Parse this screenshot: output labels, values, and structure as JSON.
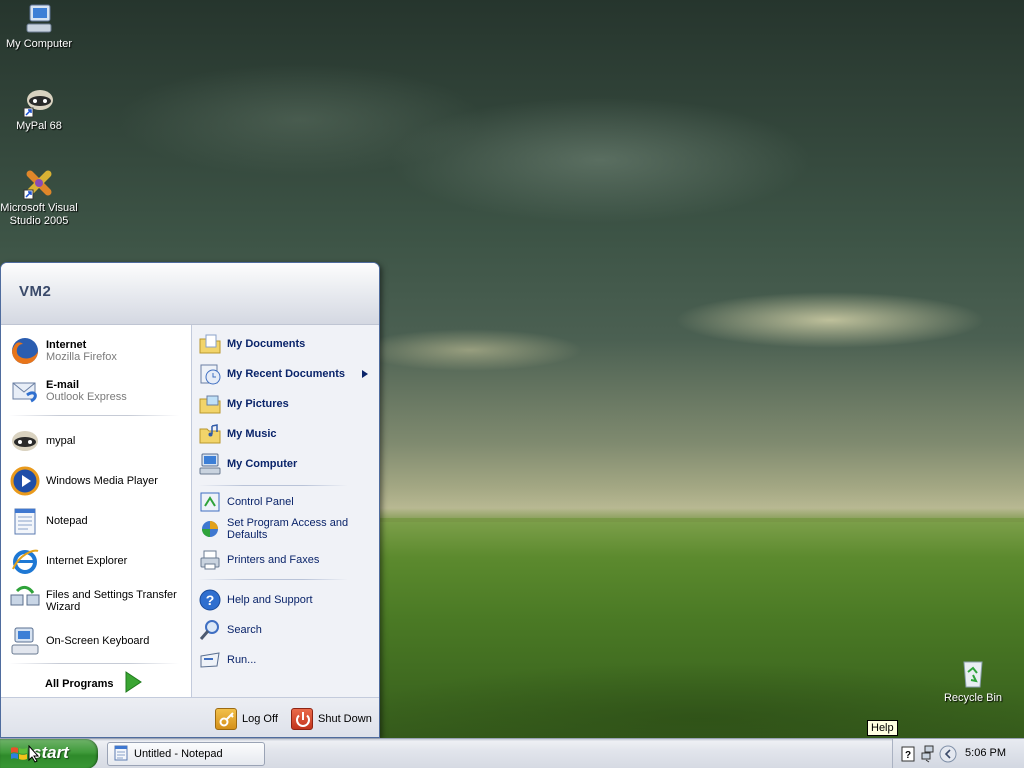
{
  "desktop": {
    "icons": [
      {
        "label": "My Computer",
        "icon": "my-computer-icon"
      },
      {
        "label": "MyPal 68",
        "icon": "mypal-icon"
      },
      {
        "label": "Microsoft Visual Studio 2005",
        "icon": "visual-studio-icon"
      },
      {
        "label": "Recycle Bin",
        "icon": "recycle-bin-icon"
      }
    ]
  },
  "start_menu": {
    "user": "VM2",
    "pinned": [
      {
        "title": "Internet",
        "subtitle": "Mozilla Firefox",
        "icon": "firefox-icon"
      },
      {
        "title": "E-mail",
        "subtitle": "Outlook Express",
        "icon": "outlook-express-icon"
      }
    ],
    "recent": [
      {
        "title": "mypal",
        "icon": "mypal-icon"
      },
      {
        "title": "Windows Media Player",
        "icon": "windows-media-player-icon"
      },
      {
        "title": "Notepad",
        "icon": "notepad-icon"
      },
      {
        "title": "Internet Explorer",
        "icon": "internet-explorer-icon"
      },
      {
        "title": "Files and Settings Transfer Wizard",
        "icon": "transfer-wizard-icon"
      },
      {
        "title": "On-Screen Keyboard",
        "icon": "keyboard-icon"
      }
    ],
    "all_programs": "All Programs",
    "places": [
      {
        "label": "My Documents",
        "icon": "folder-documents-icon"
      },
      {
        "label": "My Recent Documents",
        "icon": "recent-documents-icon"
      },
      {
        "label": "My Pictures",
        "icon": "folder-pictures-icon"
      },
      {
        "label": "My Music",
        "icon": "folder-music-icon"
      },
      {
        "label": "My Computer",
        "icon": "my-computer-icon"
      }
    ],
    "system": [
      {
        "label": "Control Panel",
        "icon": "control-panel-icon"
      },
      {
        "label": "Set Program Access and Defaults",
        "icon": "program-access-icon"
      },
      {
        "label": "Printers and Faxes",
        "icon": "printer-icon"
      }
    ],
    "help": [
      {
        "label": "Help and Support",
        "icon": "help-icon"
      },
      {
        "label": "Search",
        "icon": "search-icon"
      },
      {
        "label": "Run...",
        "icon": "run-icon"
      }
    ],
    "log_off": "Log Off",
    "shut_down": "Shut Down"
  },
  "taskbar": {
    "start_label": "start",
    "tasks": [
      {
        "label": "Untitled - Notepad",
        "icon": "notepad-icon"
      }
    ],
    "clock": "5:06 PM",
    "tooltip": "Help"
  },
  "colors": {
    "start_green": "#3f9a3a",
    "menu_blue_text": "#0a246a",
    "menu_border": "#4f6c9e"
  }
}
